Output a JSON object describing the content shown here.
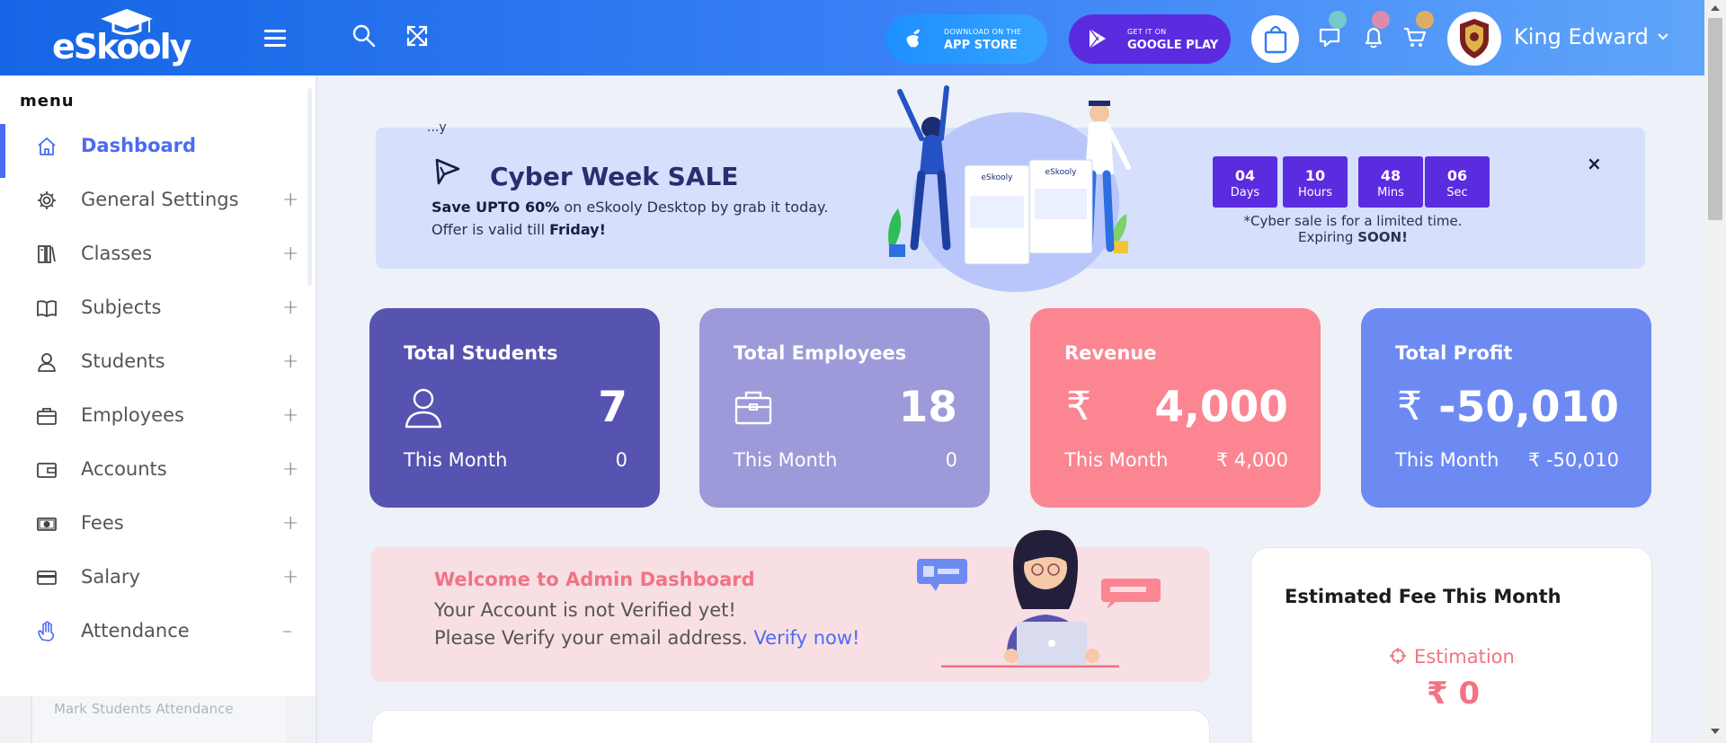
{
  "header": {
    "logo_text": "eSkooly",
    "app_store": {
      "small": "DOWNLOAD ON THE",
      "big": "APP STORE"
    },
    "google_play": {
      "small": "GET IT ON",
      "big": "GOOGLE PLAY"
    },
    "user_name": "King Edward",
    "icons": [
      "menu-icon",
      "search-icon",
      "fullscreen-icon",
      "shopping-bag-icon",
      "chat-icon",
      "bell-icon",
      "cart-icon",
      "chevron-down-icon"
    ],
    "badge_colors": [
      "#7ad3c0",
      "#f58aa0",
      "#f5b04a"
    ]
  },
  "sidebar": {
    "menu_title": "menu",
    "items": [
      {
        "label": "Dashboard",
        "icon": "home-icon",
        "toggle": "",
        "active": true
      },
      {
        "label": "General Settings",
        "icon": "gear-icon",
        "toggle": "+"
      },
      {
        "label": "Classes",
        "icon": "classes-icon",
        "toggle": "+"
      },
      {
        "label": "Subjects",
        "icon": "book-icon",
        "toggle": "+"
      },
      {
        "label": "Students",
        "icon": "student-icon",
        "toggle": "+"
      },
      {
        "label": "Employees",
        "icon": "briefcase-icon",
        "toggle": "+"
      },
      {
        "label": "Accounts",
        "icon": "wallet-icon",
        "toggle": "+"
      },
      {
        "label": "Fees",
        "icon": "money-icon",
        "toggle": "+"
      },
      {
        "label": "Salary",
        "icon": "card-icon",
        "toggle": "+"
      },
      {
        "label": "Attendance",
        "icon": "hand-icon",
        "toggle": "–"
      }
    ],
    "submenu": [
      "Mark Students Attendance"
    ]
  },
  "promo": {
    "cut_text": "...y",
    "title": "Cyber Week SALE",
    "line1_bold": "Save UPTO 60%",
    "line1_rest": " on eSkooly Desktop by grab it today.",
    "line2_pre": "Offer is valid till ",
    "line2_bold": "Friday!",
    "timer": [
      {
        "value": "04",
        "label": "Days"
      },
      {
        "value": "10",
        "label": "Hours"
      },
      {
        "value": "48",
        "label": "Mins"
      },
      {
        "value": "06",
        "label": "Sec"
      }
    ],
    "note1": "*Cyber sale is for a limited time.",
    "note2_pre": "Expiring ",
    "note2_bold": "SOON!",
    "close": "×"
  },
  "cards": [
    {
      "title": "Total Students",
      "value": "7",
      "sub": "This Month",
      "sub_value": "0",
      "icon": "student-icon",
      "color": "#5753b0"
    },
    {
      "title": "Total Employees",
      "value": "18",
      "sub": "This Month",
      "sub_value": "0",
      "icon": "briefcase-icon",
      "color": "#9c9ad8"
    },
    {
      "title": "Revenue",
      "value": "4,000",
      "sub": "This Month",
      "sub_value": "₹ 4,000",
      "icon": "rupee-icon",
      "symbol": "₹",
      "color": "#fb8591"
    },
    {
      "title": "Total Profit",
      "value": "-50,010",
      "sub": "This Month",
      "sub_value": "₹ -50,010",
      "icon": "rupee-icon",
      "symbol": "₹",
      "color": "#6d8af3"
    }
  ],
  "welcome": {
    "title": "Welcome to Admin Dashboard",
    "line1": "Your Account is not Verified yet!",
    "line2": "Please Verify your email address.",
    "link": "Verify now!"
  },
  "fee": {
    "title": "Estimated Fee This Month",
    "label": "Estimation",
    "value": "₹ 0"
  }
}
